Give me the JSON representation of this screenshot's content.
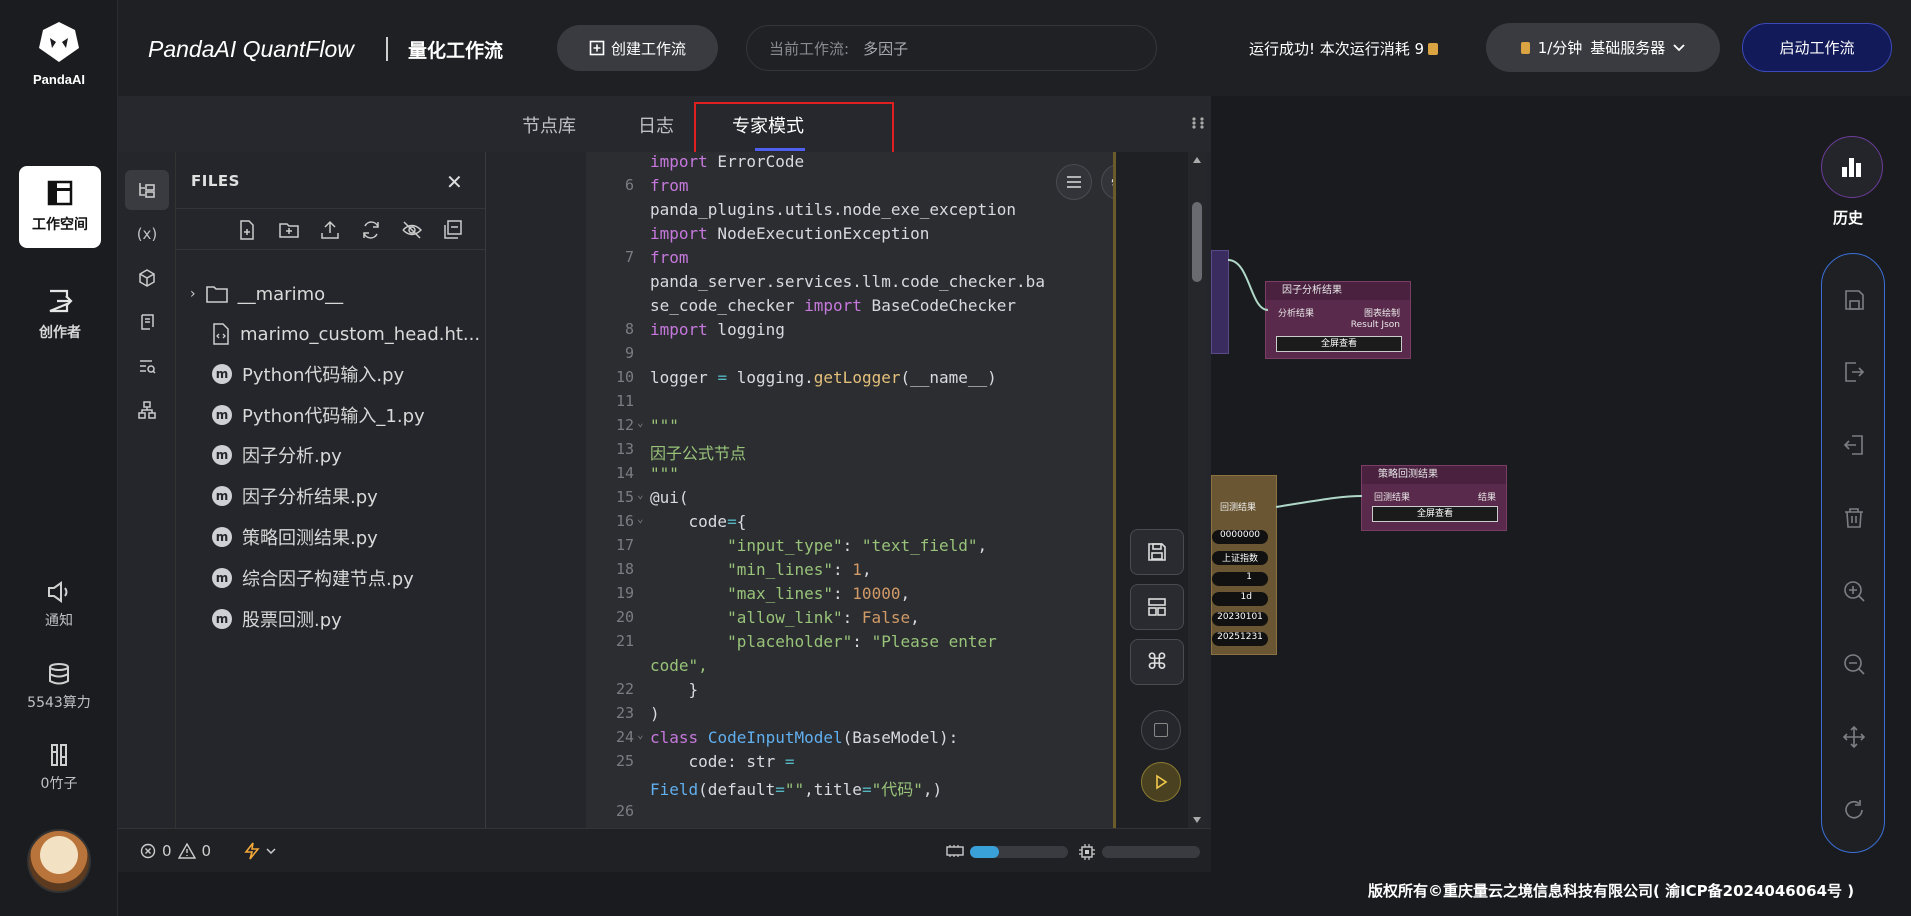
{
  "brand": {
    "logo_text": "PandaAI",
    "title": "PandaAI QuantFlow",
    "subtitle": "量化工作流"
  },
  "sidebar": {
    "items": [
      {
        "label": "工作空间",
        "icon": "workspace-icon",
        "active": true
      },
      {
        "label": "创作者",
        "icon": "creator-icon",
        "active": false
      }
    ],
    "bottom": [
      {
        "label": "通知",
        "icon": "speaker-icon"
      },
      {
        "label": "5543算力",
        "icon": "database-icon"
      },
      {
        "label": "0竹子",
        "icon": "bamboo-icon"
      }
    ]
  },
  "header": {
    "create_button": "创建工作流",
    "current_label": "当前工作流:",
    "current_value": "多因子",
    "run_status": "运行成功!  本次运行消耗 9",
    "server_rate": "1/分钟",
    "server_name": "基础服务器",
    "start_button": "启动工作流"
  },
  "panel": {
    "tabs": [
      {
        "label": "节点库",
        "active": false
      },
      {
        "label": "日志",
        "active": false
      },
      {
        "label": "专家模式",
        "active": true
      }
    ],
    "files_title": "FILES",
    "files": [
      {
        "name": "__marimo__",
        "type": "folder"
      },
      {
        "name": "marimo_custom_head.ht...",
        "type": "html"
      },
      {
        "name": "Python代码输入.py",
        "type": "marimo"
      },
      {
        "name": "Python代码输入_1.py",
        "type": "marimo"
      },
      {
        "name": "因子分析.py",
        "type": "marimo"
      },
      {
        "name": "因子分析结果.py",
        "type": "marimo"
      },
      {
        "name": "策略回测结果.py",
        "type": "marimo"
      },
      {
        "name": "综合因子构建节点.py",
        "type": "marimo"
      },
      {
        "name": "股票回测.py",
        "type": "marimo"
      }
    ],
    "status": {
      "errors": "0",
      "warnings": "0",
      "memory_fill": 0.3
    }
  },
  "canvas_nodes": {
    "factor_result": {
      "title": "因子分析结果",
      "in_label": "分析结果",
      "out1": "图表绘制",
      "out2": "Result Json",
      "button": "全屏查看"
    },
    "backtest_result": {
      "title": "策略回测结果",
      "in_label": "回测结果",
      "out1": "结果",
      "button": "全屏查看"
    },
    "partial_values": [
      "0000000",
      "上证指数",
      "1",
      "1d",
      "20230101",
      "20251231"
    ],
    "partial_label": "回测结果"
  },
  "right_toolbar": {
    "history_label": "历史"
  },
  "footer": "版权所有©重庆量云之境信息科技有限公司( 渝ICP备2024046064号 )"
}
